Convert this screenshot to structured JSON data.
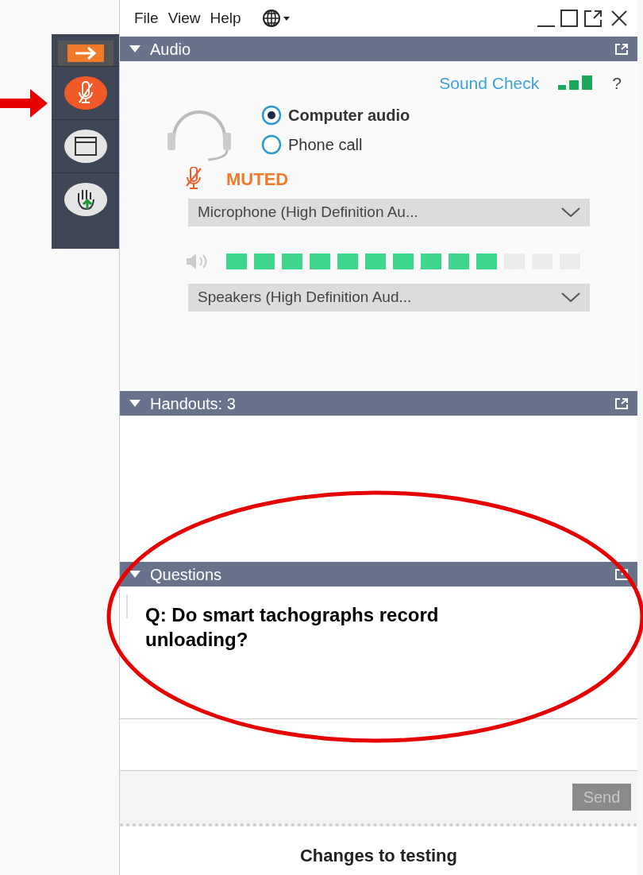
{
  "menu": [
    {
      "label": "File"
    },
    {
      "label": "View"
    },
    {
      "label": "Help"
    }
  ],
  "audio": {
    "title": "Audio",
    "expanded": true,
    "sound_check": "Sound Check",
    "help": "?",
    "options": [
      {
        "label": "Computer audio",
        "selected": true
      },
      {
        "label": "Phone call",
        "selected": false
      }
    ],
    "muted": true,
    "muted_label": "MUTED",
    "microphone": "Microphone (High Definition Au...",
    "level": 0.77,
    "speakers": "Speakers (High Definition Aud..."
  },
  "handouts": {
    "title": "Handouts: 3",
    "expanded": true
  },
  "questions": {
    "title": "Questions",
    "expanded": true,
    "question": "Q: Do smart tachographs record unloading?",
    "send": {
      "label": "Send",
      "disabled": true
    }
  },
  "footer": {
    "title": "Changes to testing"
  }
}
